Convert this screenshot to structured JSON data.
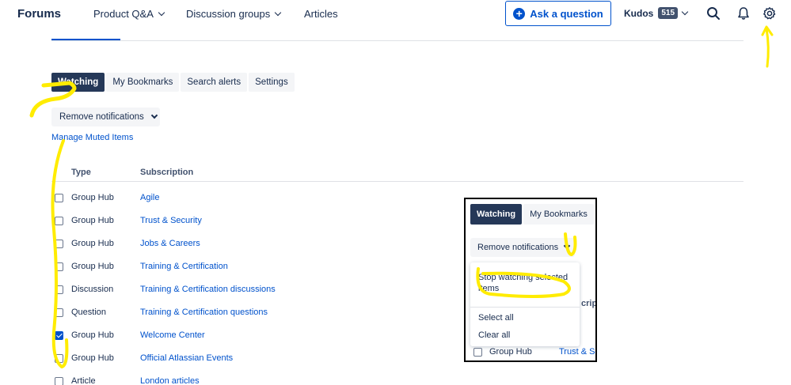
{
  "header": {
    "brand": "Forums",
    "nav": [
      "Product Q&A",
      "Discussion groups",
      "Articles"
    ],
    "ask_button": "Ask a question",
    "kudos_label": "Kudos",
    "kudos_count": "515"
  },
  "tabs": [
    "Watching",
    "My Bookmarks",
    "Search alerts",
    "Settings"
  ],
  "remove_notifications": "Remove notifications",
  "manage_muted": "Manage Muted Items",
  "table": {
    "headers": [
      "Type",
      "Subscription"
    ],
    "rows": [
      {
        "type": "Group Hub",
        "subscription": "Agile",
        "checked": false
      },
      {
        "type": "Group Hub",
        "subscription": "Trust & Security",
        "checked": false
      },
      {
        "type": "Group Hub",
        "subscription": "Jobs & Careers",
        "checked": false
      },
      {
        "type": "Group Hub",
        "subscription": "Training & Certification",
        "checked": false
      },
      {
        "type": "Discussion",
        "subscription": "Training & Certification discussions",
        "checked": false
      },
      {
        "type": "Question",
        "subscription": "Training & Certification questions",
        "checked": false
      },
      {
        "type": "Group Hub",
        "subscription": "Welcome Center",
        "checked": true
      },
      {
        "type": "Group Hub",
        "subscription": "Official Atlassian Events",
        "checked": false
      },
      {
        "type": "Article",
        "subscription": "London articles",
        "checked": false
      }
    ]
  },
  "inset": {
    "tabs": [
      "Watching",
      "My Bookmarks"
    ],
    "remove_notifications": "Remove notifications",
    "menu": {
      "stop_watching_line1": "Stop watching selected",
      "stop_watching_line2": "items",
      "select_all": "Select all",
      "clear_all": "Clear all"
    },
    "row_type": "Group Hub",
    "row_subscription": "Trust & Se",
    "ghost_header": "cript"
  },
  "colors": {
    "primary": "#0052cc",
    "tab_active": "#253858",
    "annotation": "#ffec00"
  }
}
